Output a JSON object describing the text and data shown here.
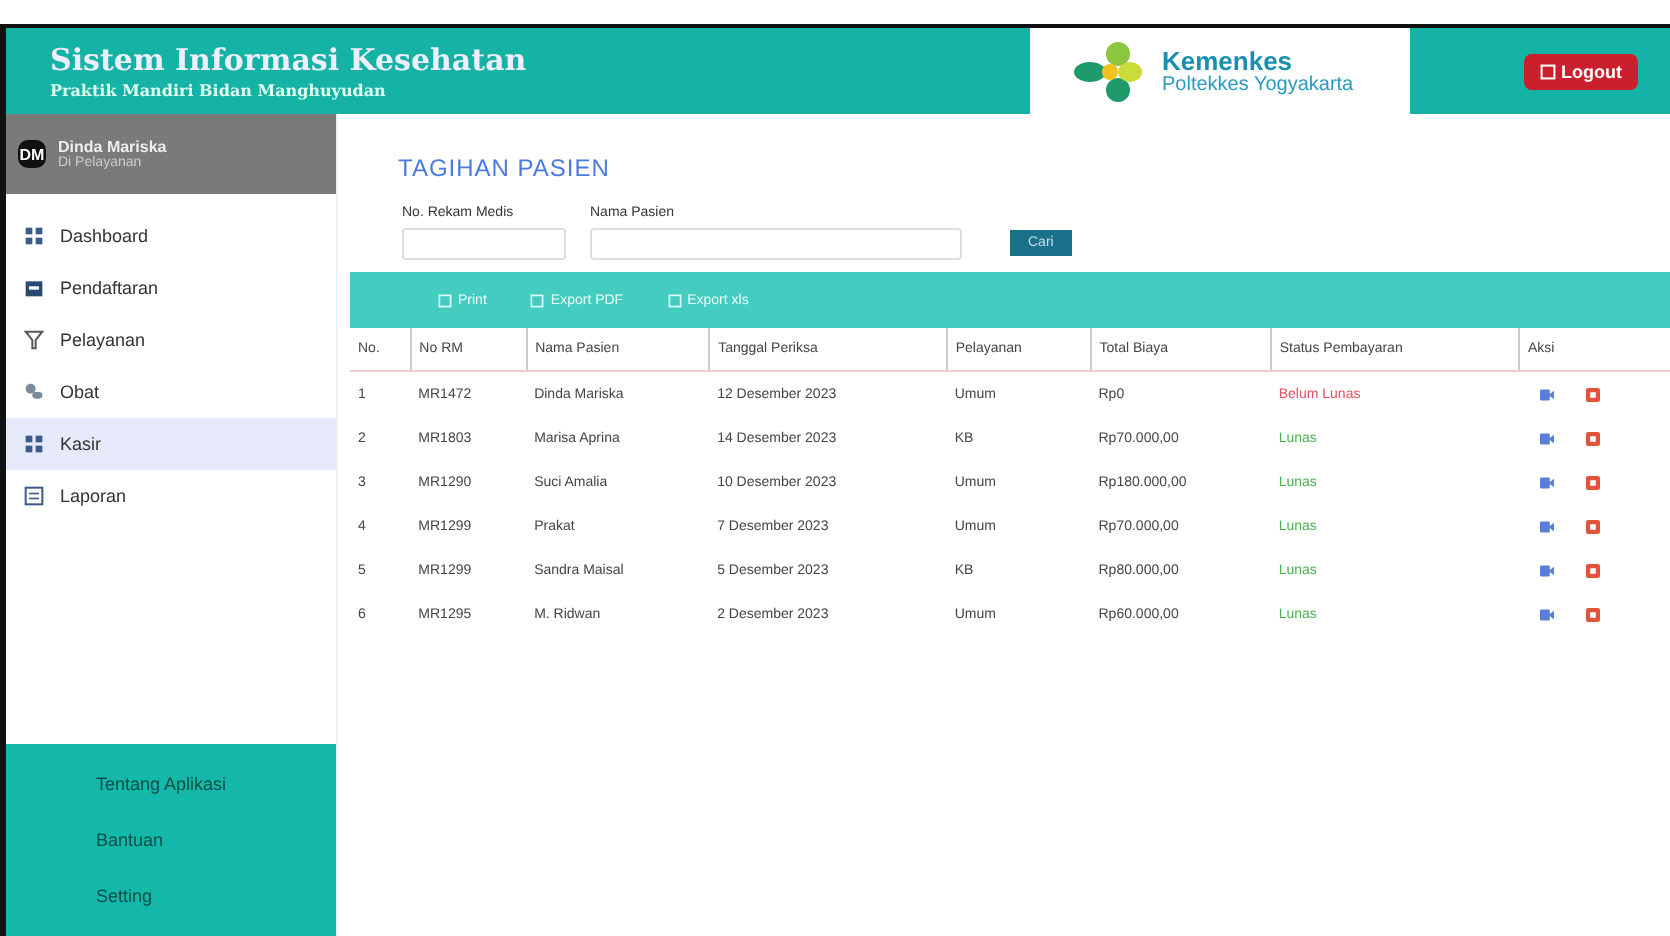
{
  "header": {
    "title": "Sistem Informasi Kesehatan",
    "subtitle": "Praktik Mandiri Bidan Manghuyudan",
    "logo_name": "Kemenkes",
    "logo_sub": "Poltekkes Yogyakarta",
    "logout": "Logout"
  },
  "user": {
    "initials": "DM",
    "name": "Dinda Mariska",
    "role": "Di Pelayanan"
  },
  "sidebar": {
    "items": [
      {
        "label": "Dashboard",
        "selected": false
      },
      {
        "label": "Pendaftaran",
        "selected": false
      },
      {
        "label": "Pelayanan",
        "selected": false
      },
      {
        "label": "Obat",
        "selected": false
      },
      {
        "label": "Kasir",
        "selected": true
      },
      {
        "label": "Laporan",
        "selected": false
      }
    ],
    "footer_items": [
      "Tentang Aplikasi",
      "Bantuan",
      "Setting"
    ]
  },
  "page_title": "TAGIHAN PASIEN",
  "filters": [
    {
      "label": "No. Rekam Medis"
    },
    {
      "label": "Nama Pasien"
    }
  ],
  "search_button": "Cari",
  "toolbar": [
    "Print",
    "Export PDF",
    "Export xls"
  ],
  "table": {
    "columns": [
      "No.",
      "No RM",
      "Nama Pasien",
      "Tanggal Periksa",
      "Pelayanan",
      "Total Biaya",
      "Status Pembayaran",
      "Aksi"
    ],
    "rows": [
      {
        "cells": [
          "1",
          "MR1472",
          "Dinda Mariska",
          "12 Desember 2023",
          "Umum",
          "Rp0"
        ],
        "status": "Belum Lunas",
        "paid": false
      },
      {
        "cells": [
          "2",
          "MR1803",
          "Marisa Aprina",
          "14 Desember 2023",
          "KB",
          "Rp70.000,00"
        ],
        "status": "Lunas",
        "paid": true
      },
      {
        "cells": [
          "3",
          "MR1290",
          "Suci Amalia",
          "10 Desember 2023",
          "Umum",
          "Rp180.000,00"
        ],
        "status": "Lunas",
        "paid": true
      },
      {
        "cells": [
          "4",
          "MR1299",
          "Prakat",
          "7 Desember 2023",
          "Umum",
          "Rp70.000,00"
        ],
        "status": "Lunas",
        "paid": true
      },
      {
        "cells": [
          "5",
          "MR1299",
          "Sandra Maisal",
          "5 Desember 2023",
          "KB",
          "Rp80.000,00"
        ],
        "status": "Lunas",
        "paid": true
      },
      {
        "cells": [
          "6",
          "MR1295",
          "M. Ridwan",
          "2 Desember 2023",
          "Umum",
          "Rp60.000,00"
        ],
        "status": "Lunas",
        "paid": true
      }
    ]
  }
}
